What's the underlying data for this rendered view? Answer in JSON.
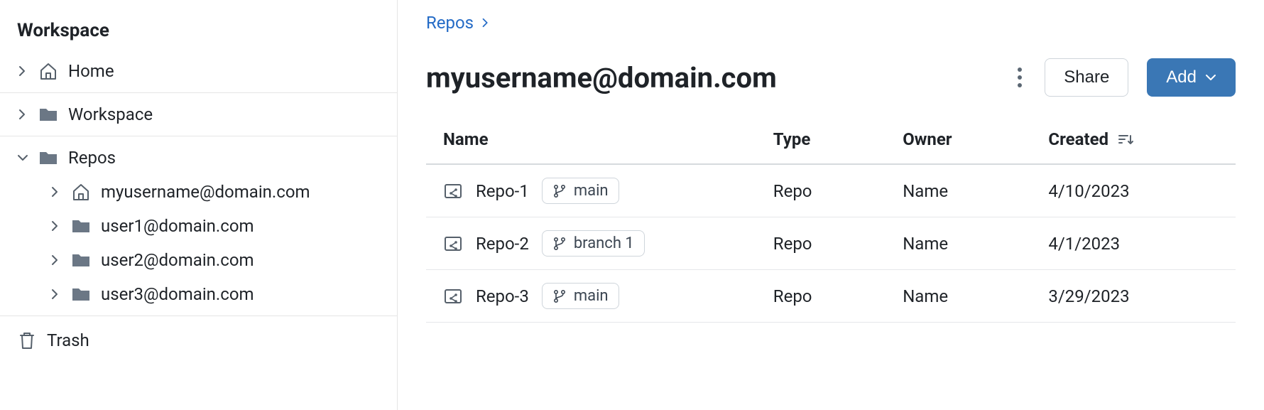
{
  "sidebar": {
    "header": "Workspace",
    "home": "Home",
    "workspace": "Workspace",
    "repos": "Repos",
    "users": [
      {
        "label": "myusername@domain.com",
        "icon": "home"
      },
      {
        "label": "user1@domain.com",
        "icon": "folder"
      },
      {
        "label": "user2@domain.com",
        "icon": "folder"
      },
      {
        "label": "user3@domain.com",
        "icon": "folder"
      }
    ],
    "trash": "Trash"
  },
  "breadcrumb": {
    "root": "Repos"
  },
  "page": {
    "title": "myusername@domain.com",
    "share": "Share",
    "add": "Add"
  },
  "table": {
    "headers": {
      "name": "Name",
      "type": "Type",
      "owner": "Owner",
      "created": "Created"
    },
    "rows": [
      {
        "name": "Repo-1",
        "branch": "main",
        "type": "Repo",
        "owner": "Name",
        "created": "4/10/2023"
      },
      {
        "name": "Repo-2",
        "branch": "branch 1",
        "type": "Repo",
        "owner": "Name",
        "created": "4/1/2023"
      },
      {
        "name": "Repo-3",
        "branch": "main",
        "type": "Repo",
        "owner": "Name",
        "created": "3/29/2023"
      }
    ]
  }
}
